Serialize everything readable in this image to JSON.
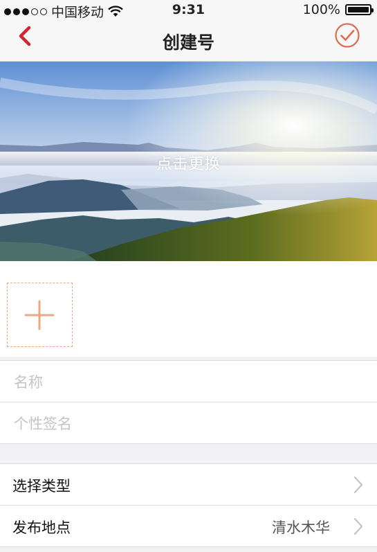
{
  "status_bar": {
    "carrier": "中国移动",
    "time": "9:31",
    "battery": "100%"
  },
  "nav": {
    "title": "创建号",
    "back_icon": "chevron-left-icon",
    "done_icon": "checkmark-circle-icon",
    "accent_color": "#d0262f",
    "done_color": "#e06a4e"
  },
  "cover": {
    "label": "点击更换"
  },
  "avatar": {
    "add_icon": "plus-icon",
    "border_color": "#f0a482"
  },
  "form": {
    "name_placeholder": "名称",
    "signature_placeholder": "个性签名"
  },
  "options": {
    "type_label": "选择类型",
    "location_label": "发布地点",
    "location_value": "清水木华"
  }
}
